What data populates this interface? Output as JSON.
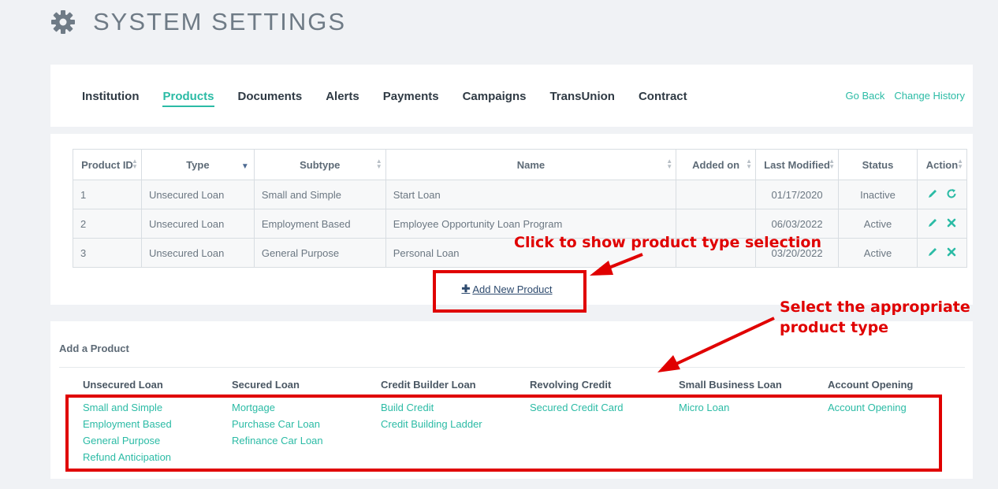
{
  "header": {
    "title": "SYSTEM SETTINGS",
    "icon": "gear-icon"
  },
  "nav": {
    "tabs": [
      {
        "label": "Institution",
        "active": false
      },
      {
        "label": "Products",
        "active": true
      },
      {
        "label": "Documents",
        "active": false
      },
      {
        "label": "Alerts",
        "active": false
      },
      {
        "label": "Payments",
        "active": false
      },
      {
        "label": "Campaigns",
        "active": false
      },
      {
        "label": "TransUnion",
        "active": false
      },
      {
        "label": "Contract",
        "active": false
      }
    ],
    "links": {
      "go_back": "Go Back",
      "change_history": "Change History"
    }
  },
  "table": {
    "columns": [
      "Product ID",
      "Type",
      "Subtype",
      "Name",
      "Added on",
      "Last Modified",
      "Status",
      "Action"
    ],
    "rows": [
      {
        "id": "1",
        "type": "Unsecured Loan",
        "subtype": "Small and Simple",
        "name": "Start Loan",
        "added_on": "",
        "last_modified": "01/17/2020",
        "status": "Inactive"
      },
      {
        "id": "2",
        "type": "Unsecured Loan",
        "subtype": "Employment Based",
        "name": "Employee Opportunity Loan Program",
        "added_on": "",
        "last_modified": "06/03/2022",
        "status": "Active"
      },
      {
        "id": "3",
        "type": "Unsecured Loan",
        "subtype": "General Purpose",
        "name": "Personal Loan",
        "added_on": "",
        "last_modified": "03/20/2022",
        "status": "Active"
      }
    ]
  },
  "add_button": {
    "label": " Add New Product"
  },
  "add_product": {
    "title": "Add a Product",
    "categories": [
      {
        "label": "Unsecured Loan",
        "items": [
          "Small and Simple",
          "Employment Based",
          "General Purpose",
          "Refund Anticipation"
        ]
      },
      {
        "label": "Secured Loan",
        "items": [
          "Mortgage",
          "Purchase Car Loan",
          "Refinance Car Loan"
        ]
      },
      {
        "label": "Credit Builder Loan",
        "items": [
          "Build Credit",
          "Credit Building Ladder"
        ]
      },
      {
        "label": "Revolving Credit",
        "items": [
          "Secured Credit Card"
        ]
      },
      {
        "label": "Small Business Loan",
        "items": [
          "Micro Loan"
        ]
      },
      {
        "label": "Account Opening",
        "items": [
          "Account Opening"
        ]
      }
    ]
  },
  "annotations": {
    "click_hint": "Click to show product type selection",
    "select_hint_line1": "Select the appropriate",
    "select_hint_line2": "product type"
  },
  "colors": {
    "accent": "#2bbba5",
    "annotation_red": "#e00000",
    "inactive_red": "#e02020",
    "navy": "#2d4a6e"
  }
}
